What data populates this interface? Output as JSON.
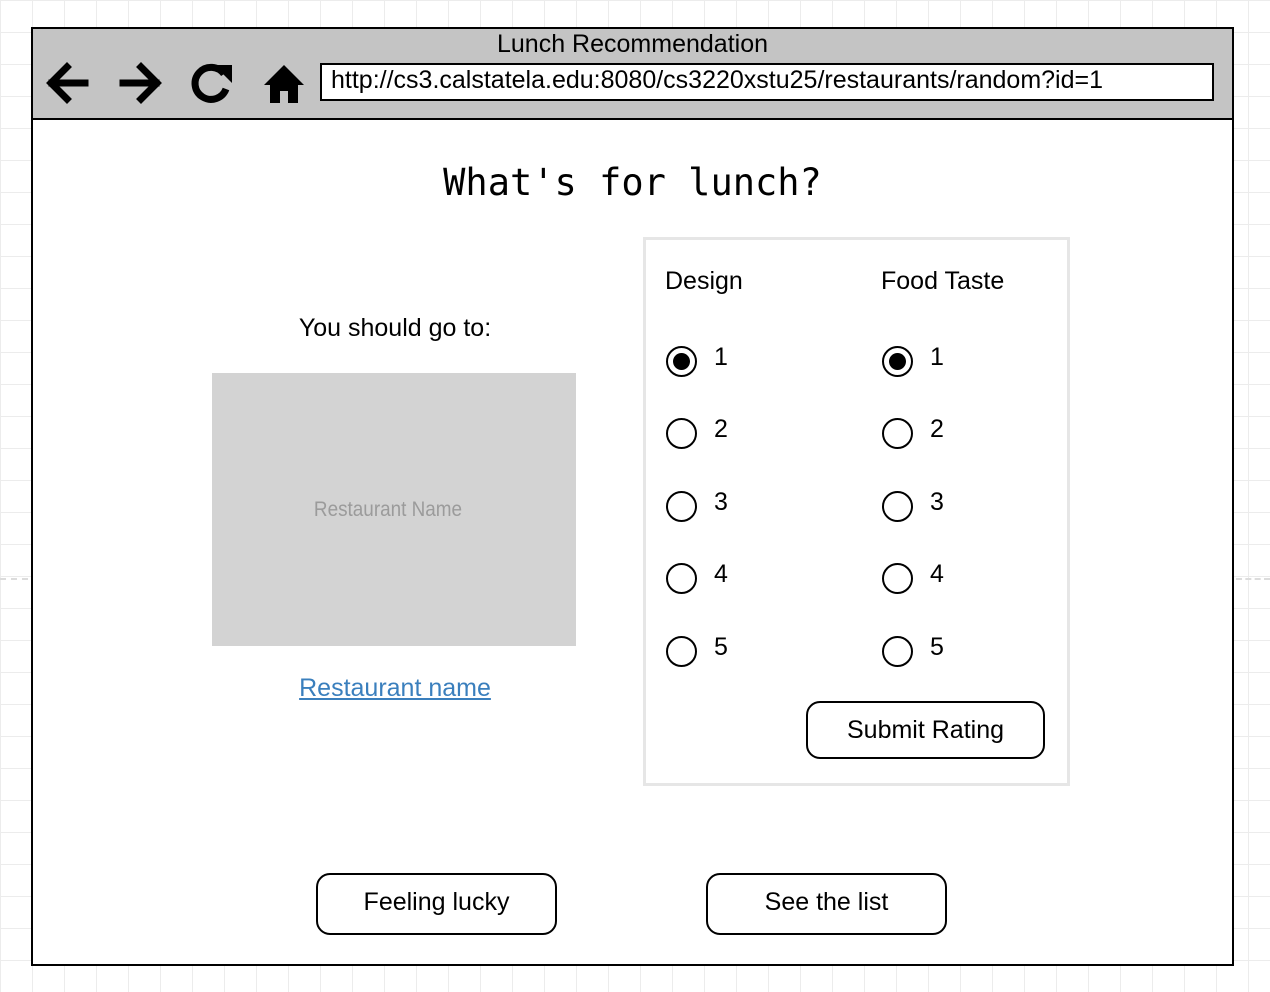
{
  "browser": {
    "window_title": "Lunch Recommendation",
    "url": "http://cs3.calstatela.edu:8080/cs3220xstu25/restaurants/random?id=1",
    "nav_icons": [
      "back-arrow-icon",
      "forward-arrow-icon",
      "reload-icon",
      "home-icon"
    ]
  },
  "page": {
    "heading": "What's for lunch?"
  },
  "recommendation": {
    "prompt": "You should go to:",
    "image_caption": "Restaurant Name",
    "link_text": "Restaurant name"
  },
  "rating": {
    "design": {
      "label": "Design",
      "options": [
        "1",
        "2",
        "3",
        "4",
        "5"
      ],
      "selected": "1"
    },
    "taste": {
      "label": "Food Taste",
      "options": [
        "1",
        "2",
        "3",
        "4",
        "5"
      ],
      "selected": "1"
    },
    "submit_label": "Submit Rating"
  },
  "actions": {
    "feeling_lucky_label": "Feeling lucky",
    "see_list_label": "See the list"
  },
  "colors": {
    "chrome": "#c4c4c4",
    "link": "#3a7fbd",
    "image_placeholder": "#d3d3d3",
    "image_caption": "#9b9b9b",
    "panel_border": "#e6e6e6"
  }
}
